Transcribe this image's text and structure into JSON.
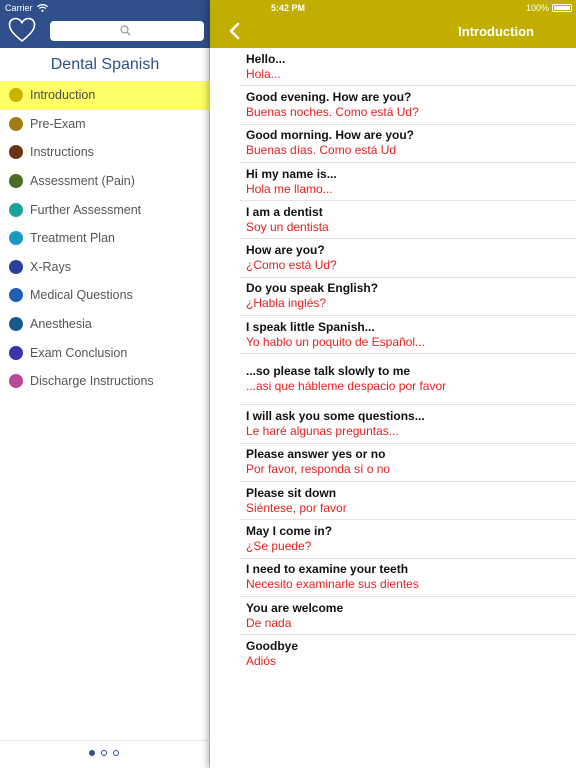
{
  "status": {
    "carrier": "Carrier",
    "time": "5:42 PM",
    "battery": "100%"
  },
  "sidebar": {
    "title": "Dental Spanish",
    "items": [
      {
        "label": "Introduction",
        "color": "#c8b400",
        "active": true
      },
      {
        "label": "Pre-Exam",
        "color": "#a07d12"
      },
      {
        "label": "Instructions",
        "color": "#6b3513"
      },
      {
        "label": "Assessment (Pain)",
        "color": "#4d6b22"
      },
      {
        "label": "Further Assessment",
        "color": "#1aa39a"
      },
      {
        "label": "Treatment Plan",
        "color": "#1a9ac0"
      },
      {
        "label": "X-Rays",
        "color": "#2a3f9c"
      },
      {
        "label": "Medical Questions",
        "color": "#1e5fb0"
      },
      {
        "label": "Anesthesia",
        "color": "#1a5a8a"
      },
      {
        "label": "Exam Conclusion",
        "color": "#3a34a8"
      },
      {
        "label": "Discharge Instructions",
        "color": "#b84a9a"
      }
    ],
    "pager": {
      "pages": 3,
      "current": 1
    }
  },
  "main": {
    "title": "Introduction",
    "phrases": [
      {
        "en": "Hello...",
        "es": "Hola..."
      },
      {
        "en": "Good evening. How are you?",
        "es": "Buenas noches. Como está Ud?"
      },
      {
        "en": "Good morning. How are you?",
        "es": "Buenas días. Como está Ud"
      },
      {
        "en": "Hi my name is...",
        "es": "Hola me llamo..."
      },
      {
        "en": "I am a dentist",
        "es": "Soy un dentista"
      },
      {
        "en": "How are you?",
        "es": "¿Como está Ud?"
      },
      {
        "en": "Do you speak English?",
        "es": "¿Habla inglés?"
      },
      {
        "en": "I speak little Spanish...",
        "es": "Yo hablo un poquito de Español..."
      },
      {
        "en": "...so please talk slowly to me",
        "es": "...asi que hábleme despacio por favor"
      },
      {
        "en": "I will ask you some questions...",
        "es": "Le haré algunas preguntas..."
      },
      {
        "en": "Please answer yes or no",
        "es": "Por favor, responda sí o no"
      },
      {
        "en": "Please sit down",
        "es": "Siéntese, por favor"
      },
      {
        "en": "May I come in?",
        "es": "¿Se puede?"
      },
      {
        "en": "I need to examine your teeth",
        "es": "Necesito examinarle sus dientes"
      },
      {
        "en": "You are welcome",
        "es": "De nada"
      },
      {
        "en": "Goodbye",
        "es": "Adiós"
      }
    ]
  },
  "colors": {
    "sidebar_header": "#2e4f8a",
    "main_header": "#c1ae00",
    "highlight": "#ffff66",
    "spanish_text": "#e62020"
  },
  "icons": {
    "favorites": "heart-icon",
    "search": "search-icon",
    "back": "chevron-left-icon",
    "wifi": "wifi-icon"
  }
}
